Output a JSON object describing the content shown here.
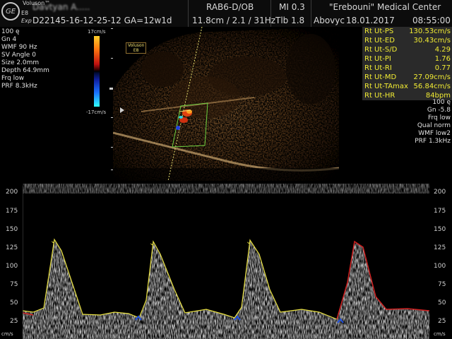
{
  "header": {
    "logo_text": "GE",
    "voluson_brand": "Voluson™",
    "voluson_model": "E8",
    "voluson_sub": "Exp",
    "patient_name": "Davtyan A.....",
    "patient_id_line": "D22145-16-12-25-12  GA=12w1d",
    "probe": "RAB6-D/OB",
    "mi": "MI  0.3",
    "hospital": "\"Erebouni\" Medical Center",
    "depth_info": "11.8cm / 2.1 / 31Hz",
    "tib": "Tlb  1.8",
    "user": "Abovyc",
    "date": "18.01.2017",
    "time": "08:55:00"
  },
  "left_info": [
    "100 ę",
    "Gn  4",
    "WMF 90 Hz",
    "SV Angle  0",
    "Size  2.0mm",
    "Depth 64.9mm",
    "Frq low",
    "PRF  8.3kHz"
  ],
  "colorbar": {
    "top_label": "17cm/s",
    "bottom_label": "-17cm/s"
  },
  "image_badge": {
    "line1": "Voluson",
    "line2": "E8"
  },
  "measurements": [
    {
      "label": "Rt Ut-PS",
      "value": "130.53cm/s"
    },
    {
      "label": "Rt Ut-ED",
      "value": "30.43cm/s"
    },
    {
      "label": "Rt Ut-S/D",
      "value": "4.29"
    },
    {
      "label": "Rt Ut-PI",
      "value": "1.76"
    },
    {
      "label": "Rt Ut-RI",
      "value": "0.77"
    },
    {
      "label": "Rt Ut-MD",
      "value": "27.09cm/s"
    },
    {
      "label": "Rt Ut-TAmax",
      "value": "56.84cm/s"
    },
    {
      "label": "Rt Ut-HR",
      "value": "84bpm"
    }
  ],
  "right_params": [
    "100 ę",
    "Gn -5.8",
    "Frq low",
    "Qual norm",
    "WMF low2",
    "PRF  1.3kHz"
  ],
  "velocity_scale": {
    "labels": [
      "200",
      "175",
      "150",
      "125",
      "100",
      "75",
      "50",
      "25"
    ],
    "unit": "cm/s"
  },
  "colors": {
    "measure_text": "#f2ec33",
    "envelope_yellow": "#e8e040",
    "envelope_red": "#d02020",
    "marker_blue": "#2050e0",
    "meas_panel_bg": "#2a2a2a"
  }
}
